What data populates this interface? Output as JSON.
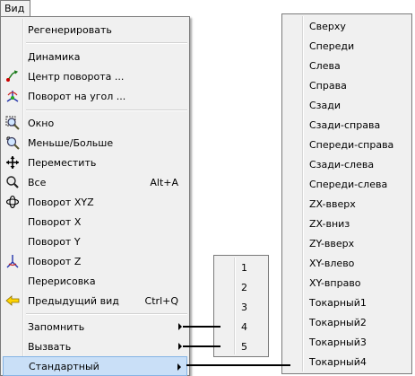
{
  "menubar": {
    "view_label": "Вид"
  },
  "main_menu": {
    "items": [
      {
        "label": "Регенерировать",
        "shortcut": ""
      },
      {
        "label": "Динамика",
        "shortcut": ""
      },
      {
        "label": "Центр поворота ...",
        "shortcut": ""
      },
      {
        "label": "Поворот на угол ...",
        "shortcut": ""
      },
      {
        "label": "Окно",
        "shortcut": ""
      },
      {
        "label": "Меньше/Больше",
        "shortcut": ""
      },
      {
        "label": "Переместить",
        "shortcut": ""
      },
      {
        "label": "Все",
        "shortcut": "Alt+A"
      },
      {
        "label": "Поворот XYZ",
        "shortcut": ""
      },
      {
        "label": "Поворот X",
        "shortcut": ""
      },
      {
        "label": "Поворот Y",
        "shortcut": ""
      },
      {
        "label": "Поворот Z",
        "shortcut": ""
      },
      {
        "label": "Перерисовка",
        "shortcut": ""
      },
      {
        "label": "Предыдущий вид",
        "shortcut": "Ctrl+Q"
      },
      {
        "label": "Запомнить",
        "shortcut": ""
      },
      {
        "label": "Вызвать",
        "shortcut": ""
      },
      {
        "label": "Стандартный",
        "shortcut": ""
      }
    ]
  },
  "numbers_menu": {
    "items": [
      "1",
      "2",
      "3",
      "4",
      "5"
    ]
  },
  "standard_menu": {
    "items": [
      "Сверху",
      "Спереди",
      "Слева",
      "Справа",
      "Сзади",
      "Сзади-справа",
      "Спереди-справа",
      "Сзади-слева",
      "Спереди-слева",
      "ZX-вверх",
      "ZX-вниз",
      "ZY-вверх",
      "XY-влево",
      "XY-вправо",
      "Токарный1",
      "Токарный2",
      "Токарный3",
      "Токарный4"
    ]
  },
  "icons": {
    "center_rotation": "center-rotation-icon",
    "rotate_angle": "rotate-angle-icon",
    "window_zoom": "zoom-window-icon",
    "zoom_in_out": "zoom-in-out-icon",
    "pan": "pan-move-icon",
    "zoom_all": "zoom-all-icon",
    "rotate_xyz": "rotate-xyz-icon",
    "rotate_z": "rotate-z-axes-icon",
    "previous_view": "previous-view-arrow-icon"
  },
  "colors": {
    "menu_bg": "#f0f0f0",
    "highlight_bg": "#c9dff7",
    "highlight_border": "#86b4e4"
  }
}
